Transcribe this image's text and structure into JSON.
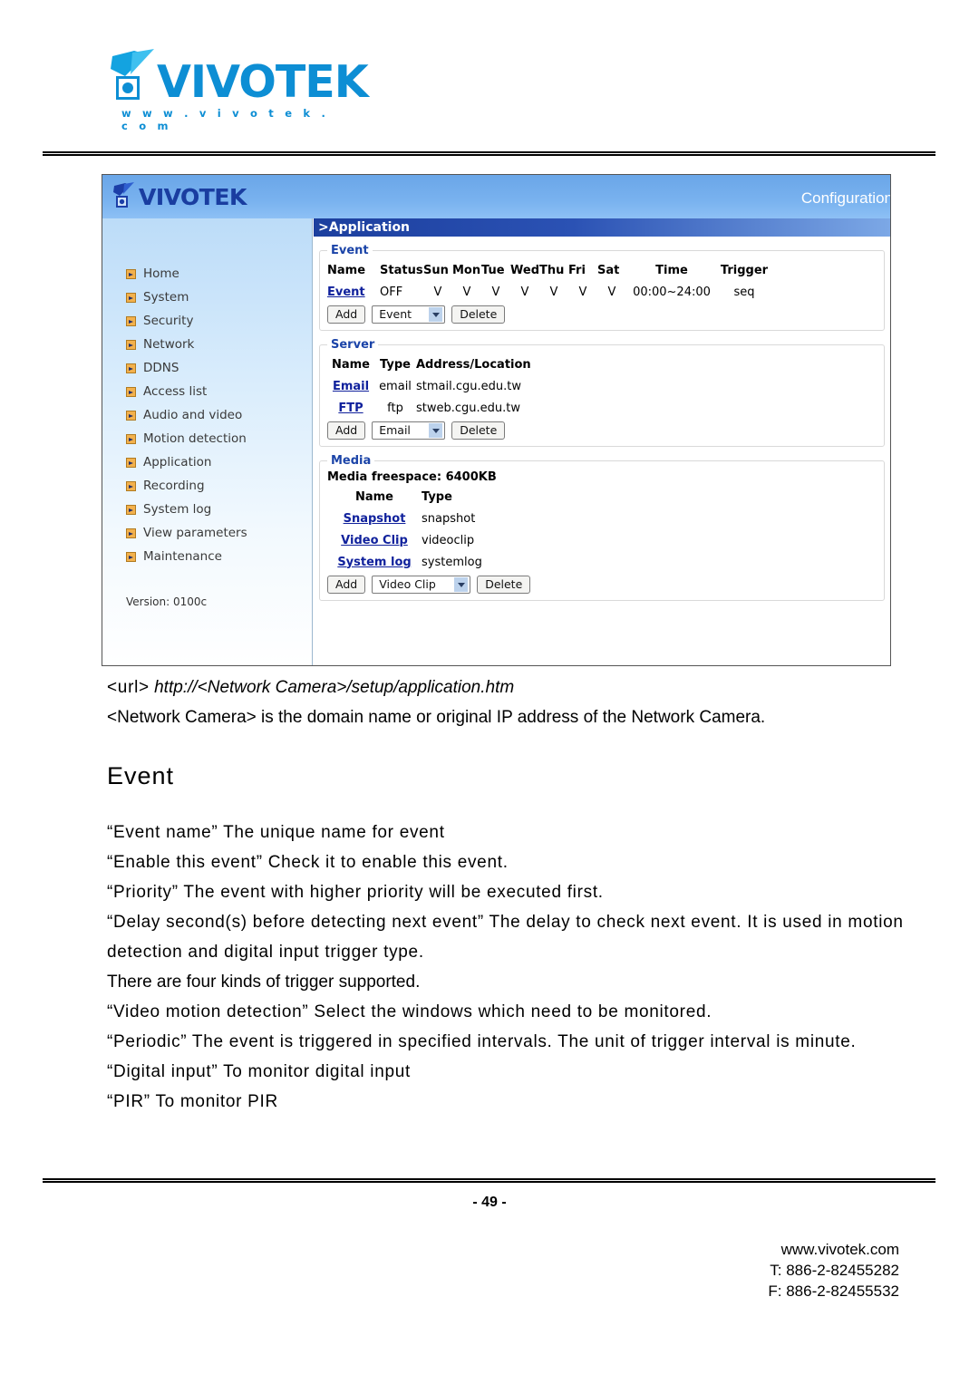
{
  "brand": {
    "logo_word": "VIVOTEK",
    "logo_url": "w w w . v i v o t e k . c o m",
    "logo_mark_name": "vivotek-camera-logo-icon"
  },
  "screenshot": {
    "header": {
      "logo_word": "VIVOTEK",
      "right_label": "Configuration"
    },
    "page_title": ">Application",
    "sidebar": {
      "items": [
        {
          "label": "Home"
        },
        {
          "label": "System"
        },
        {
          "label": "Security"
        },
        {
          "label": "Network"
        },
        {
          "label": "DDNS"
        },
        {
          "label": "Access list"
        },
        {
          "label": "Audio and video"
        },
        {
          "label": "Motion detection"
        },
        {
          "label": "Application"
        },
        {
          "label": "Recording"
        },
        {
          "label": "System log"
        },
        {
          "label": "View parameters"
        },
        {
          "label": "Maintenance"
        }
      ],
      "version": "Version: 0100c"
    },
    "event_panel": {
      "legend": "Event",
      "headers": [
        "Name",
        "Status",
        "Sun",
        "Mon",
        "Tue",
        "Wed",
        "Thu",
        "Fri",
        "Sat",
        "Time",
        "Trigger"
      ],
      "rows": [
        {
          "name": "Event",
          "status": "OFF",
          "sun": "V",
          "mon": "V",
          "tue": "V",
          "wed": "V",
          "thu": "V",
          "fri": "V",
          "sat": "V",
          "time": "00:00~24:00",
          "trigger": "seq"
        }
      ],
      "add_label": "Add",
      "select_value": "Event",
      "delete_label": "Delete"
    },
    "server_panel": {
      "legend": "Server",
      "headers": [
        "Name",
        "Type",
        "Address/Location"
      ],
      "rows": [
        {
          "name": "Email",
          "type": "email",
          "address": "stmail.cgu.edu.tw"
        },
        {
          "name": "FTP",
          "type": "ftp",
          "address": "stweb.cgu.edu.tw"
        }
      ],
      "add_label": "Add",
      "select_value": "Email",
      "delete_label": "Delete"
    },
    "media_panel": {
      "legend": "Media",
      "freespace": "Media freespace: 6400KB",
      "headers": [
        "Name",
        "Type"
      ],
      "rows": [
        {
          "name": "Snapshot",
          "type": "snapshot"
        },
        {
          "name": "Video Clip",
          "type": "videoclip"
        },
        {
          "name": "System log",
          "type": "systemlog"
        }
      ],
      "add_label": "Add",
      "select_value": "Video Clip",
      "delete_label": "Delete"
    }
  },
  "document": {
    "url_label": "<url>",
    "url_value": "http://<Network Camera>/setup/application.htm",
    "url_note": "<Network Camera> is the domain name or original IP address of the Network Camera.",
    "heading": "Event",
    "paragraphs": [
      "“Event name” The unique name for event",
      "“Enable this event” Check it to enable this event.",
      "“Priority” The event with higher priority will be executed first.",
      "“Delay second(s) before detecting next event” The delay to check next event. It is used in motion detection and digital input trigger type.",
      "There are four kinds of trigger supported.",
      "“Video motion detection” Select the windows which need to be monitored.",
      "“Periodic” The event is triggered in specified intervals. The unit of trigger interval is minute.",
      "“Digital input” To monitor digital input",
      "“PIR” To monitor PIR"
    ]
  },
  "footer": {
    "page_number": "- 49 -",
    "website": "www.vivotek.com",
    "tel": "T: 886-2-82455282",
    "fax": "F: 886-2-82455532"
  }
}
